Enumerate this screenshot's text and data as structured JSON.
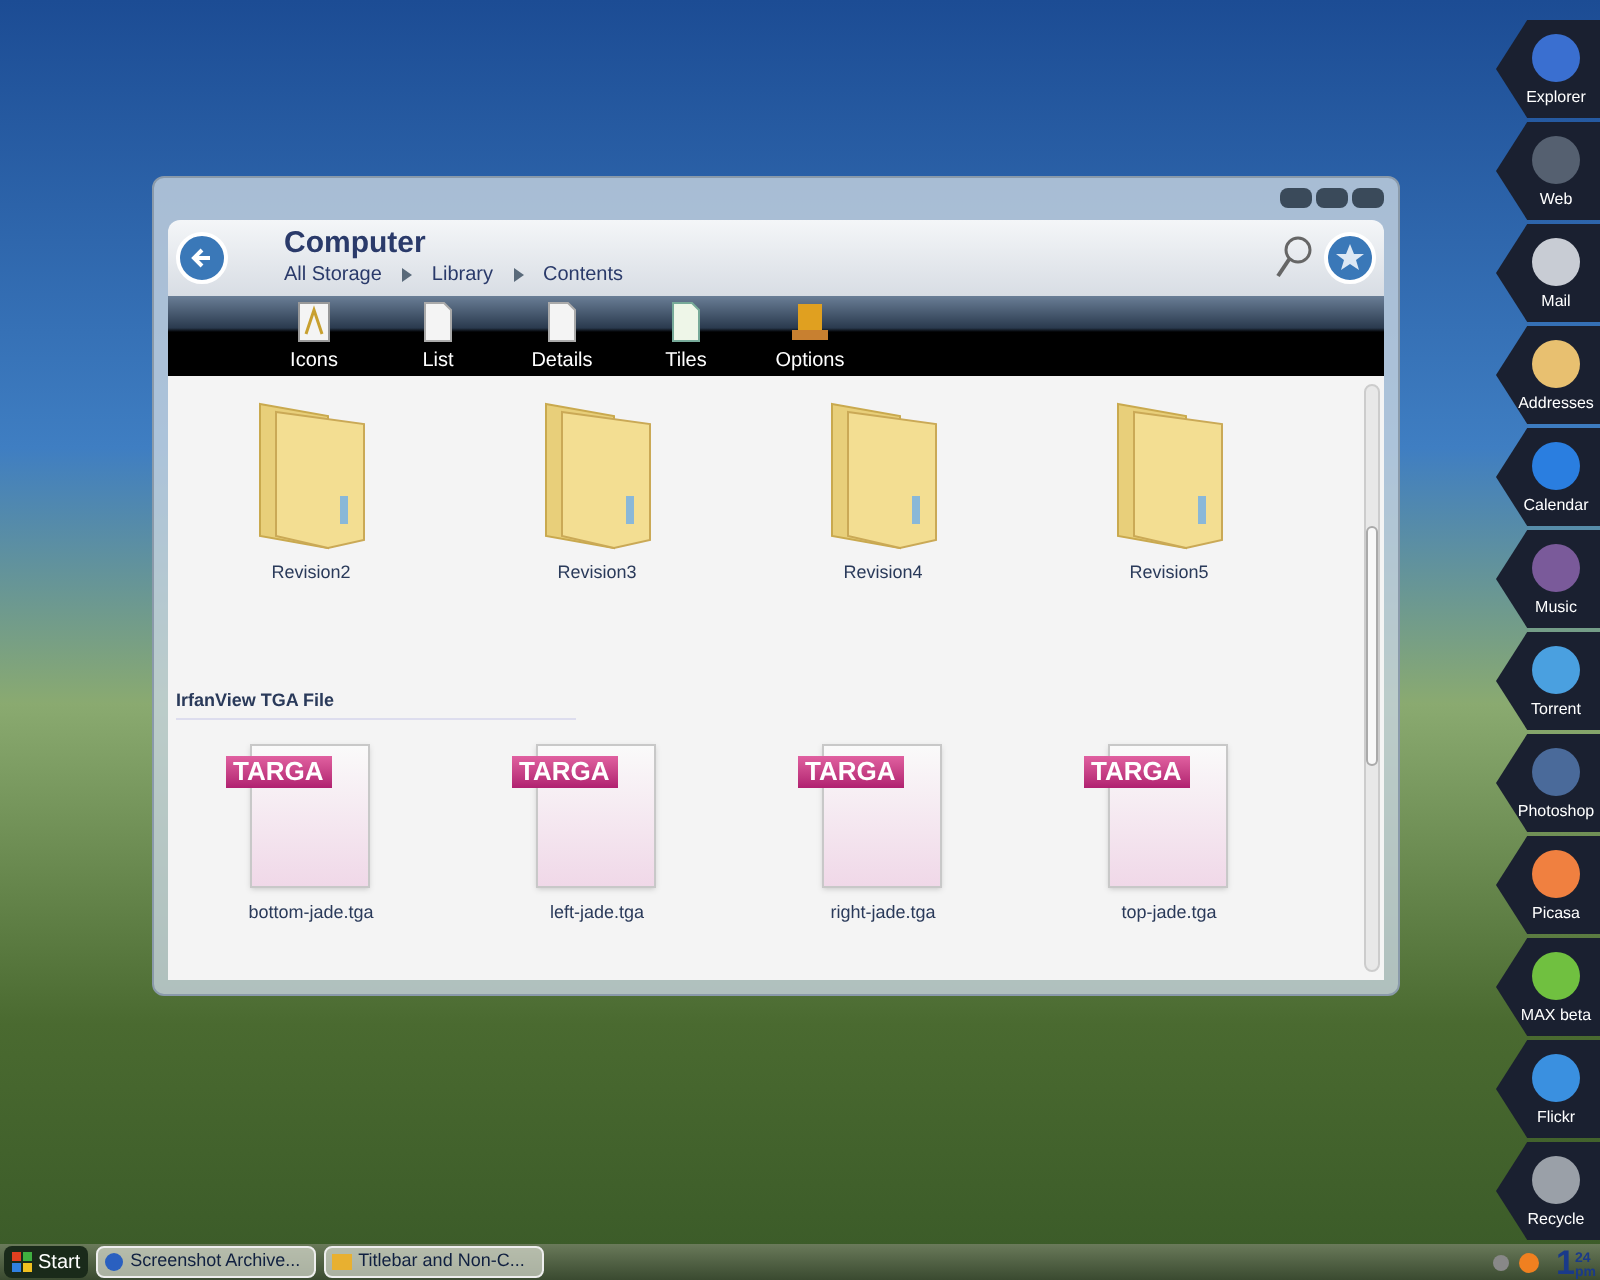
{
  "window": {
    "title": "Computer",
    "breadcrumb": [
      "All Storage",
      "Library",
      "Contents"
    ],
    "toolbar": [
      {
        "label": "Icons",
        "kind": "icons"
      },
      {
        "label": "List",
        "kind": "page"
      },
      {
        "label": "Details",
        "kind": "page"
      },
      {
        "label": "Tiles",
        "kind": "tiles"
      },
      {
        "label": "Options",
        "kind": "options"
      }
    ],
    "folders": [
      {
        "name": "Revision2"
      },
      {
        "name": "Revision3"
      },
      {
        "name": "Revision4"
      },
      {
        "name": "Revision5"
      }
    ],
    "group_heading": "IrfanView TGA File",
    "files": [
      {
        "name": "bottom-jade.tga",
        "badge": "TARGA"
      },
      {
        "name": "left-jade.tga",
        "badge": "TARGA"
      },
      {
        "name": "right-jade.tga",
        "badge": "TARGA"
      },
      {
        "name": "top-jade.tga",
        "badge": "TARGA"
      }
    ]
  },
  "dock": [
    {
      "label": "Explorer",
      "color": "#3a6fd0"
    },
    {
      "label": "Web",
      "color": "#556070"
    },
    {
      "label": "Mail",
      "color": "#c8ccd4"
    },
    {
      "label": "Addresses",
      "color": "#e8c070"
    },
    {
      "label": "Calendar",
      "color": "#2a7ee0"
    },
    {
      "label": "Music",
      "color": "#7a5a9a"
    },
    {
      "label": "Torrent",
      "color": "#4aa0e0"
    },
    {
      "label": "Photoshop",
      "color": "#4a6a9a"
    },
    {
      "label": "Picasa",
      "color": "#f08040"
    },
    {
      "label": "MAX beta",
      "color": "#70c040"
    },
    {
      "label": "Flickr",
      "color": "#3a90e0"
    },
    {
      "label": "Recycle",
      "color": "#9aa0a8"
    }
  ],
  "taskbar": {
    "start": "Start",
    "tasks": [
      {
        "label": "Screenshot Archive...",
        "kind": "globe"
      },
      {
        "label": "Titlebar and Non-C...",
        "kind": "folder"
      }
    ],
    "clock": {
      "hour": "1",
      "minutes": "24",
      "period": "pm"
    }
  }
}
